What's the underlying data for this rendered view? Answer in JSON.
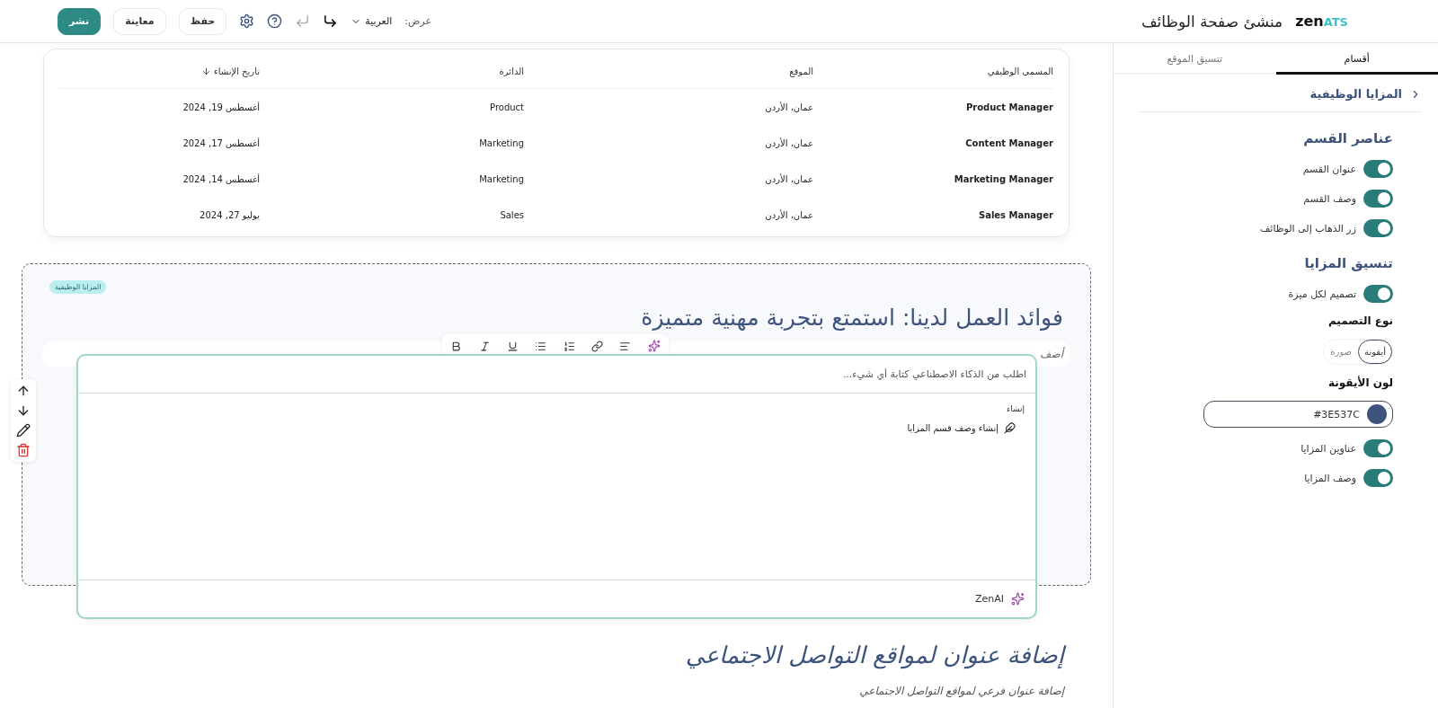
{
  "header": {
    "logo_main": "zen",
    "logo_accent": "ATS",
    "title": "منشئ صفحة الوظائف",
    "view_label": "عرض:",
    "language": "العربية",
    "undo": {
      "disabled": true
    },
    "redo": {
      "disabled": false
    },
    "buttons": [
      {
        "label": "حفظ",
        "kind": "outline"
      },
      {
        "label": "معاينة",
        "kind": "outline"
      },
      {
        "label": "نشر",
        "kind": "primary"
      }
    ]
  },
  "table": {
    "columns": [
      {
        "label": "المسمى الوظيفي",
        "sorted": false
      },
      {
        "label": "الموقع",
        "sorted": false
      },
      {
        "label": "الدائرة",
        "sorted": false
      },
      {
        "label": "تاريخ الإنشاء",
        "sorted": true
      }
    ],
    "rows": [
      [
        "Product Manager",
        "عمان، الأردن",
        "Product",
        "أغسطس 19, 2024"
      ],
      [
        "Content Manager",
        "عمان، الأردن",
        "Marketing",
        "أغسطس 17, 2024"
      ],
      [
        "Marketing Manager",
        "عمان، الأردن",
        "Marketing",
        "أغسطس 14, 2024"
      ],
      [
        "Sales Manager",
        "عمان، الأردن",
        "Sales",
        "يوليو 27, 2024"
      ]
    ]
  },
  "section": {
    "tag": "المزايا الوظيفية",
    "title": "فوائد العمل لدينا: استمتع بتجربة مهنية متميزة",
    "description": "أضف"
  },
  "ai_panel": {
    "placeholder": "اطلب من الذكاء الاصطناعي كتابة أي شيء...",
    "group_label": "إنشاء",
    "suggestions": [
      "إنشاء وصف قسم المزايا"
    ],
    "brand": "ZenAI"
  },
  "next_section": {
    "title": "إضافة عنوان لمواقع التواصل الاجتماعي",
    "subtitle": "إضافة عنوان فرعي لمواقع التواصل الاجتماعي"
  },
  "sidebar": {
    "tabs": [
      {
        "label": "أقسام",
        "selected": true
      },
      {
        "label": "تنسيق الموقع",
        "selected": false
      }
    ],
    "breadcrumb": "المزايا الوظيفية",
    "groups": [
      {
        "title": "عناصر القسم",
        "items": [
          {
            "kind": "toggle",
            "label": "عنوان القسم",
            "on": true
          },
          {
            "kind": "toggle",
            "label": "وصف القسم",
            "on": true
          },
          {
            "kind": "toggle",
            "label": "زر الذهاب إلى الوظائف",
            "on": true
          }
        ]
      },
      {
        "title": "تنسيق المزايا",
        "items": [
          {
            "kind": "toggle",
            "label": "تصميم لكل ميزة",
            "on": true
          },
          {
            "kind": "segmented",
            "label": "نوع التصميم",
            "options": [
              {
                "label": "أيقونة",
                "selected": true
              },
              {
                "label": "صورة",
                "selected": false
              }
            ]
          },
          {
            "kind": "color",
            "label": "لون الأيقونة",
            "value": "#3E537C",
            "color": "#3e537c"
          },
          {
            "kind": "toggle",
            "label": "عناوين المزايا",
            "on": true
          },
          {
            "kind": "toggle",
            "label": "وصف المزايا",
            "on": true
          }
        ]
      }
    ]
  }
}
